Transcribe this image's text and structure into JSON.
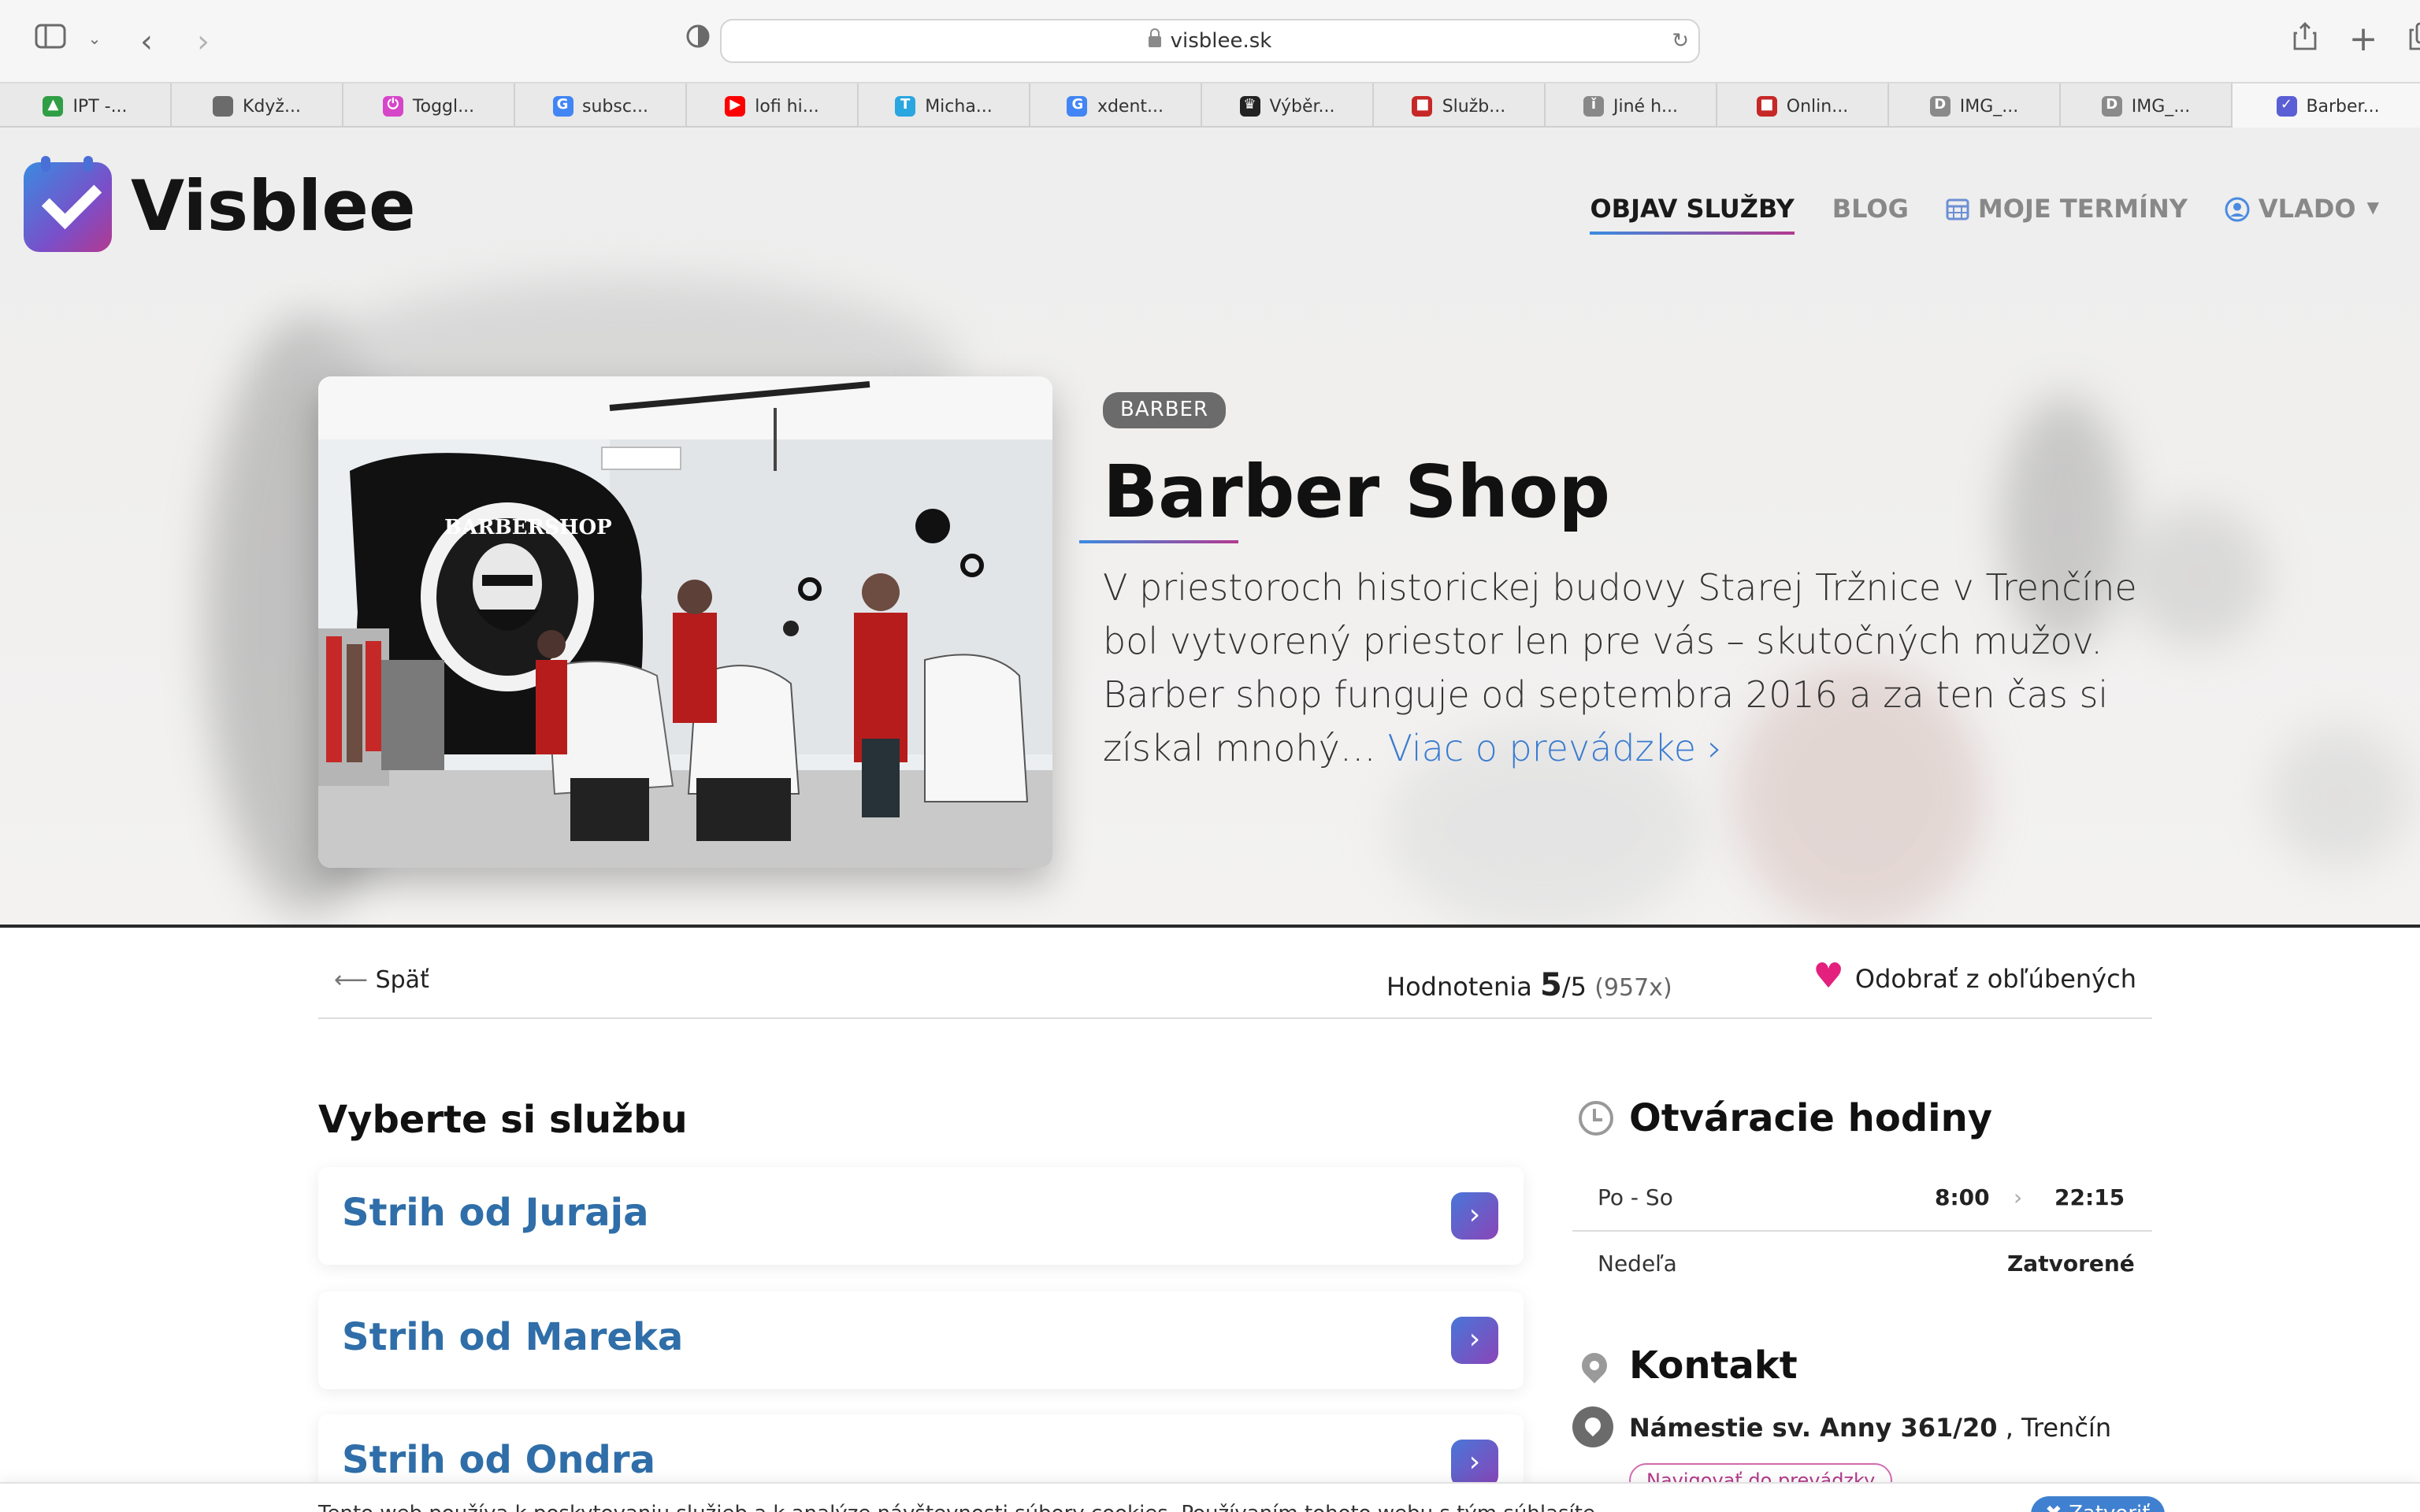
{
  "browser": {
    "url": "visblee.sk",
    "tabs": [
      {
        "label": "IPT -...",
        "color": "#2f9e44",
        "glyph": "▲"
      },
      {
        "label": "Když...",
        "color": "#6b6b6b",
        "glyph": ""
      },
      {
        "label": "Toggl...",
        "color": "#d646c9",
        "glyph": "⏻"
      },
      {
        "label": "subsc...",
        "color": "#4285f4",
        "glyph": "G"
      },
      {
        "label": "lofi hi...",
        "color": "#ff0000",
        "glyph": "▶"
      },
      {
        "label": "Micha...",
        "color": "#2aa6e0",
        "glyph": "T"
      },
      {
        "label": "xdent...",
        "color": "#4285f4",
        "glyph": "G"
      },
      {
        "label": "Výběr...",
        "color": "#222222",
        "glyph": "♛"
      },
      {
        "label": "Služb...",
        "color": "#c62828",
        "glyph": "■"
      },
      {
        "label": "Jiné h...",
        "color": "#888888",
        "glyph": "ǐ"
      },
      {
        "label": "Onlin...",
        "color": "#c62828",
        "glyph": "■"
      },
      {
        "label": "IMG_...",
        "color": "#8a8a8a",
        "glyph": "D"
      },
      {
        "label": "IMG_...",
        "color": "#8a8a8a",
        "glyph": "D"
      },
      {
        "label": "Barber...",
        "color": "#5a5fd6",
        "glyph": "✓"
      }
    ]
  },
  "header": {
    "logo_text": "Visblee",
    "nav": {
      "objav": "OBJAV SLUŽBY",
      "blog": "BLOG",
      "terminy": "MOJE TERMÍNY",
      "user": "VLADO"
    }
  },
  "hero": {
    "badge": "BARBER",
    "title": "Barber Shop",
    "description": "V priestoroch historickej budovy Starej Tržnice v Trenčíne bol vytvorený priestor len pre vás – skutočných mužov. Barber shop funguje od septembra 2016 a za ten čas si získal mnohý…",
    "more_link": "Viac o prevádzke"
  },
  "bar": {
    "back": "Späť",
    "rating_label": "Hodnotenia",
    "rating_value": "5",
    "rating_max": "/5",
    "rating_count": "(957x)",
    "favorite": "Odobrať z obľúbených"
  },
  "services": {
    "title": "Vyberte si službu",
    "items": [
      "Strih od Juraja",
      "Strih od Mareka",
      "Strih od Ondra"
    ]
  },
  "hours": {
    "title": "Otváracie hodiny",
    "rows": [
      {
        "days": "Po - So",
        "open": "8:00",
        "close": "22:15"
      },
      {
        "days": "Nedeľa",
        "status": "Zatvorené"
      }
    ]
  },
  "contact": {
    "title": "Kontakt",
    "street": "Námestie sv. Anny 361/20",
    "city": ", Trenčín",
    "navigate": "Navigovať do prevádzky"
  },
  "cookie": {
    "text": "Tento web používa k poskytovaniu služieb a k analýze návštevnosti súbory cookies. Používaním tohoto webu s tým súhlasíte.",
    "close": "Zatvoriť"
  }
}
